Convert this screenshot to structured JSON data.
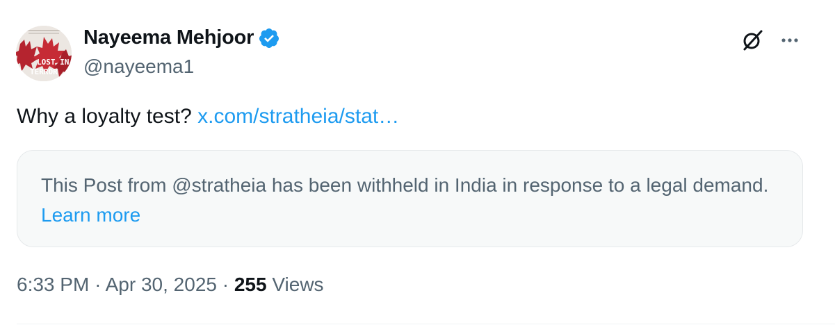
{
  "author": {
    "display_name": "Nayeema Mehjoor",
    "handle": "@nayeema1",
    "verified": true,
    "avatar": {
      "icon": "book-cover-avatar",
      "cover_text_line1": "LOST IN",
      "cover_text_line2": "TERROR"
    }
  },
  "actions": {
    "grok_icon": "grok-icon",
    "more_icon": "more-icon"
  },
  "tweet": {
    "text": "Why a loyalty test?",
    "link_text": "x.com/stratheia/stat…"
  },
  "withheld": {
    "message": "This Post from @stratheia has been withheld in India in response to a legal demand.",
    "learn_more": "Learn more"
  },
  "meta": {
    "time": "6:33 PM",
    "separator": "·",
    "date": "Apr 30, 2025",
    "views_count": "255",
    "views_label": "Views"
  },
  "colors": {
    "link": "#1d9bf0",
    "text": "#0f1419",
    "secondary": "#536471",
    "verified_badge": "#1d9bf0",
    "card_bg": "#f7f9f9"
  }
}
